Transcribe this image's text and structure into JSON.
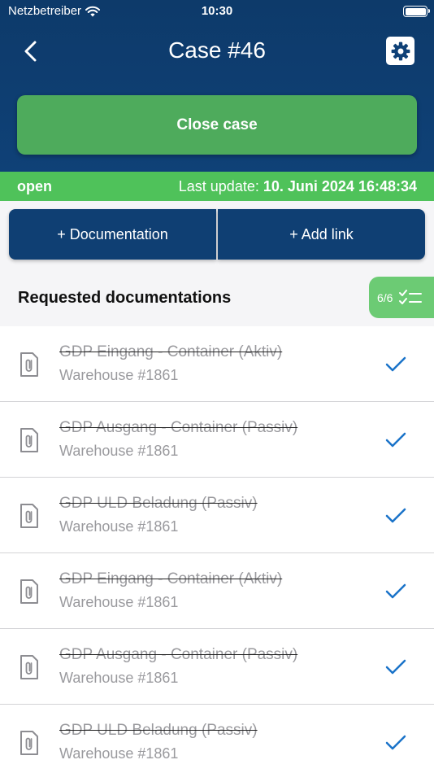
{
  "status_bar": {
    "carrier": "Netzbetreiber",
    "time": "10:30"
  },
  "header": {
    "title": "Case #46",
    "close_case_label": "Close case"
  },
  "status": {
    "state": "open",
    "last_update_label": "Last update:",
    "last_update_value": "10. Juni 2024 16:48:34"
  },
  "actions": {
    "documentation_label": "+ Documentation",
    "add_link_label": "+ Add link"
  },
  "section": {
    "title": "Requested documentations",
    "progress": "6/6"
  },
  "documentations": [
    {
      "title": "GDP Eingang - Container (Aktiv)",
      "location": "Warehouse #1861"
    },
    {
      "title": "GDP Ausgang - Container (Passiv)",
      "location": "Warehouse #1861"
    },
    {
      "title": "GDP ULD Beladung (Passiv)",
      "location": "Warehouse #1861"
    },
    {
      "title": "GDP Eingang - Container (Aktiv)",
      "location": "Warehouse #1861"
    },
    {
      "title": "GDP Ausgang - Container (Passiv)",
      "location": "Warehouse #1861"
    },
    {
      "title": "GDP ULD Beladung (Passiv)",
      "location": "Warehouse #1861"
    }
  ],
  "colors": {
    "header": "#0f4177",
    "close_button": "#4eab5c",
    "status_strip": "#4fc25a",
    "action_button": "#0f3f73",
    "check": "#1a73c9"
  },
  "icons": {
    "back": "chevron-left-icon",
    "settings": "gear-icon",
    "document": "paperclip-document-icon",
    "done": "checkmark-icon",
    "progress": "checklist-icon"
  }
}
